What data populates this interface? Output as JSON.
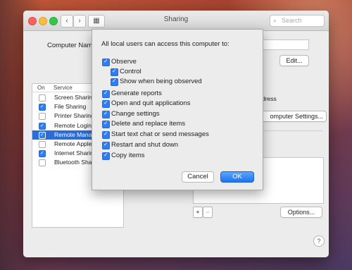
{
  "window": {
    "title": "Sharing"
  },
  "toolbar": {
    "back_glyph": "‹",
    "forward_glyph": "›",
    "grid_glyph": "▦",
    "search_placeholder": "Search"
  },
  "computer_name": {
    "label": "Computer Name",
    "edit_button": "Edit..."
  },
  "services_table": {
    "col_on": "On",
    "col_service": "Service",
    "rows": [
      {
        "name": "Screen Sharing",
        "on": false,
        "selected": false
      },
      {
        "name": "File Sharing",
        "on": true,
        "selected": false
      },
      {
        "name": "Printer Sharing",
        "on": false,
        "selected": false
      },
      {
        "name": "Remote Login",
        "on": true,
        "selected": false
      },
      {
        "name": "Remote Manag",
        "on": true,
        "selected": true
      },
      {
        "name": "Remote Apple",
        "on": false,
        "selected": false
      },
      {
        "name": "Internet Sharin",
        "on": true,
        "selected": false
      },
      {
        "name": "Bluetooth Shar",
        "on": false,
        "selected": false
      }
    ]
  },
  "right_panel": {
    "address_fragment": "dress",
    "computer_settings_button": "omputer Settings...",
    "add_symbol": "+",
    "remove_symbol": "−",
    "options_button": "Options..."
  },
  "sheet": {
    "heading": "All local users can access this computer to:",
    "options": {
      "observe": "Observe",
      "control": "Control",
      "show_observed": "Show when being observed",
      "generate_reports": "Generate reports",
      "open_quit": "Open and quit applications",
      "change_settings": "Change settings",
      "delete_replace": "Delete and replace items",
      "text_chat": "Start text chat or send messages",
      "restart_shutdown": "Restart and shut down",
      "copy_items": "Copy items"
    },
    "cancel": "Cancel",
    "ok": "OK"
  },
  "help_symbol": "?",
  "colors": {
    "accent": "#2d7df5",
    "selection": "#2a6dd9"
  }
}
